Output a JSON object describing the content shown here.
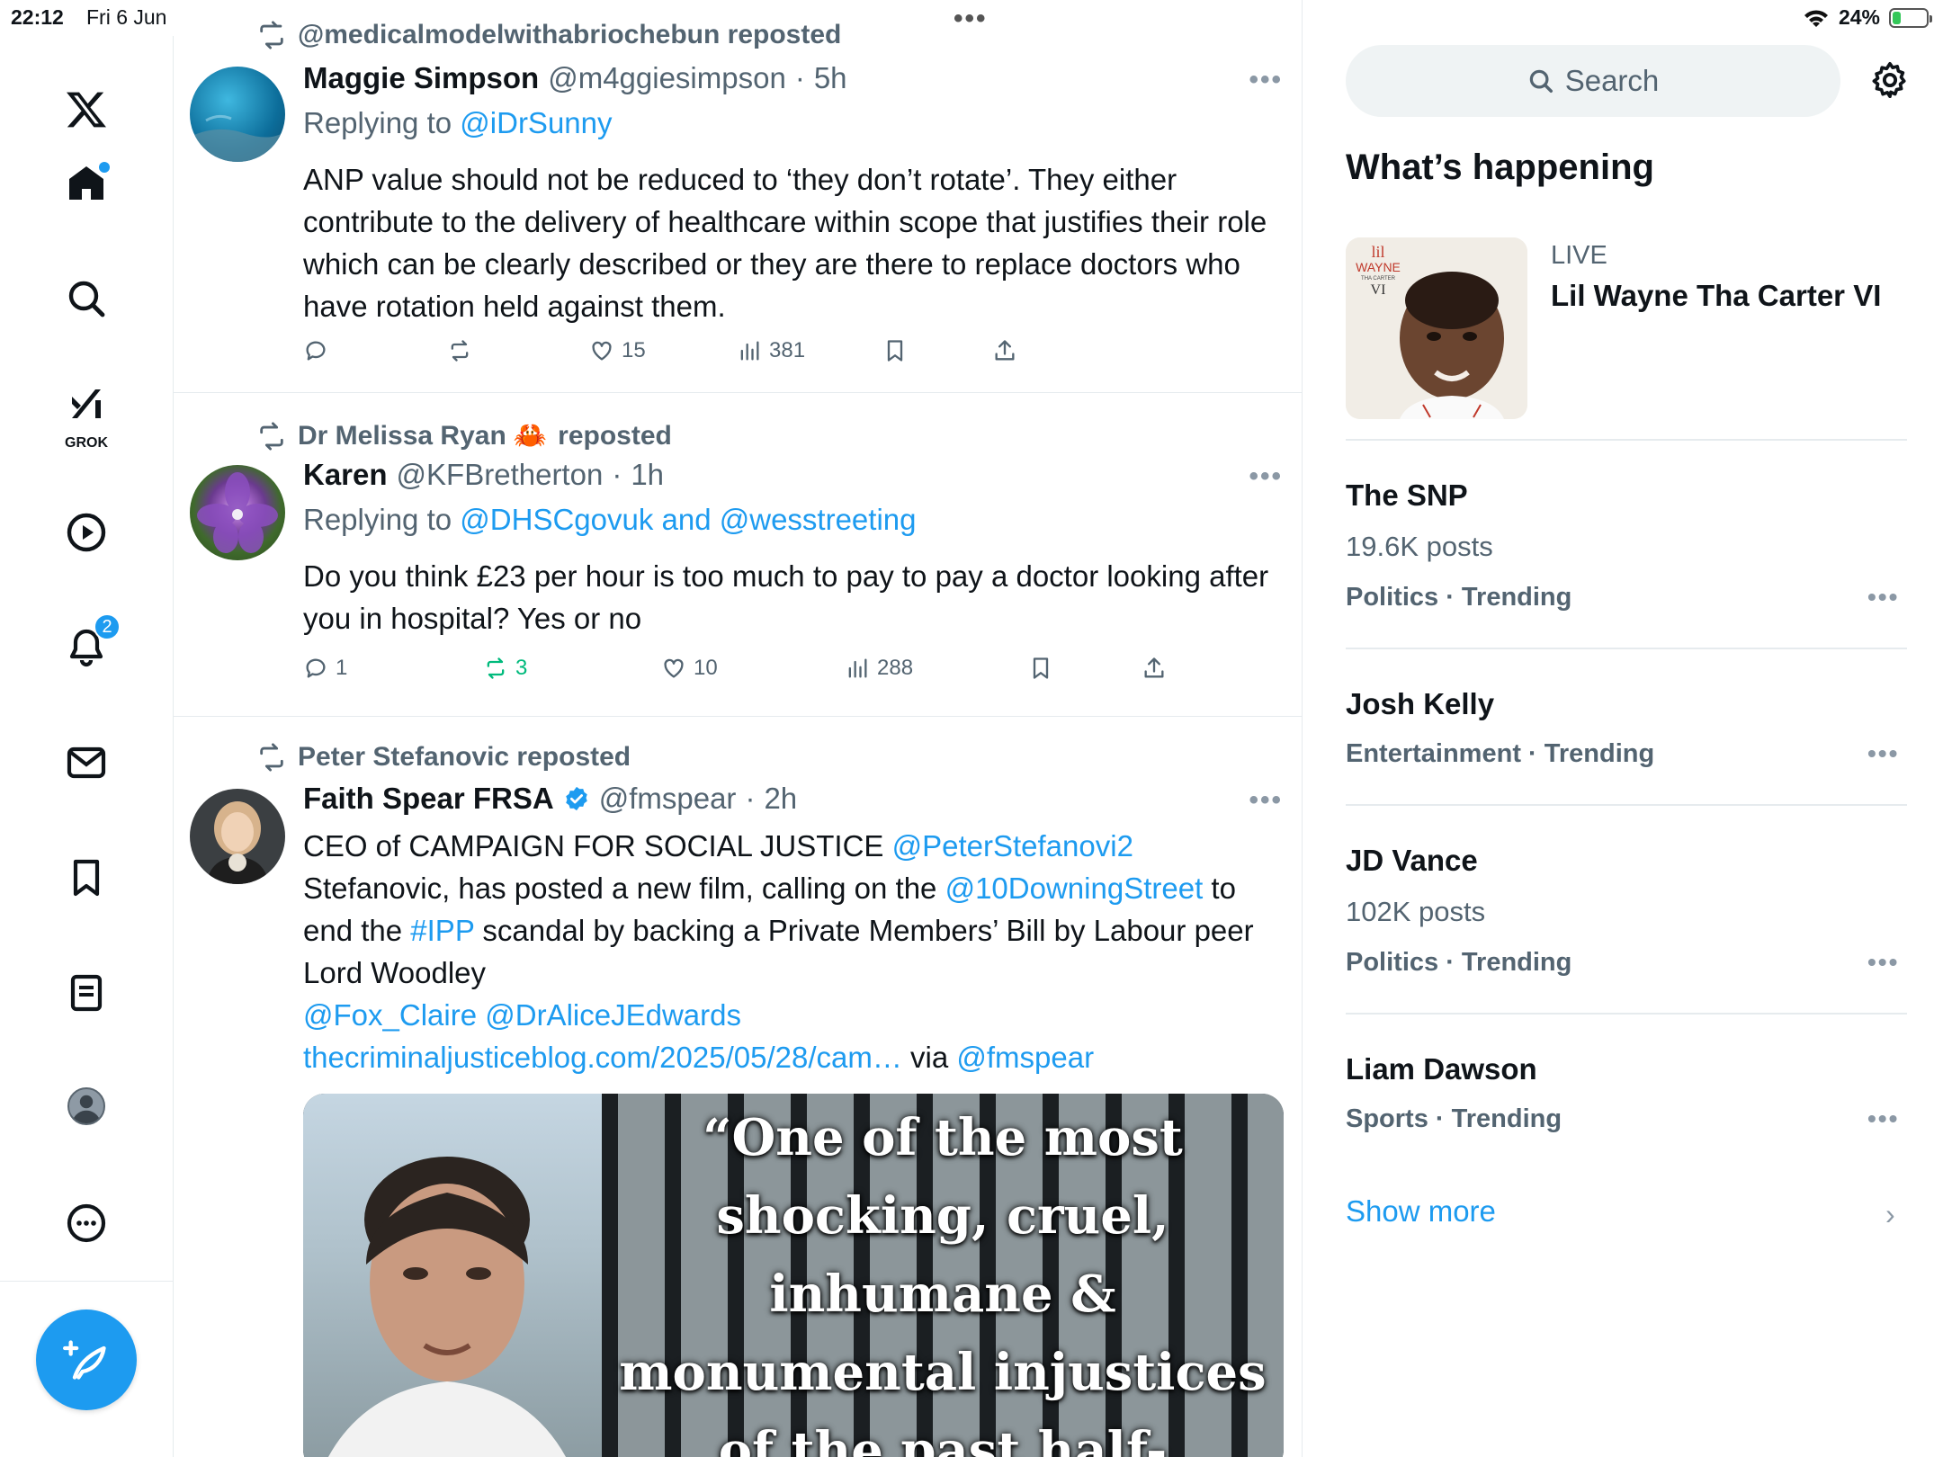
{
  "status_bar": {
    "time": "22:12",
    "date": "Fri 6 Jun",
    "battery": "24%",
    "battery_level": 0.24
  },
  "nav": {
    "notifications_badge": "2",
    "grok_label": "GROK"
  },
  "posts": [
    {
      "reposted_by": "@medicalmodelwithabriochebun reposted",
      "name": "Maggie Simpson",
      "handle": "@m4ggiesimpson",
      "time": "5h",
      "replying_prefix": "Replying to",
      "replying_to": "@iDrSunny",
      "text": "ANP value should not be reduced to ‘they don’t rotate’. They either contribute to the delivery of healthcare within scope that justifies their role which can be clearly described or they are there to replace doctors who have rotation held against them.",
      "replies": "",
      "reposts": "",
      "likes": "15",
      "views": "381"
    },
    {
      "reposted_by_name": "Dr Melissa Ryan",
      "reposted_by_emoji": "🦀",
      "reposted_suffix": "reposted",
      "name": "Karen",
      "handle": "@KFBretherton",
      "time": "1h",
      "replying_prefix": "Replying to",
      "replying_to": "@DHSCgovuk and @wesstreeting",
      "text": "Do you think  £23 per hour is too much to pay to pay a doctor looking after you in hospital? Yes or no",
      "replies": "1",
      "reposts": "3",
      "likes": "10",
      "views": "288"
    },
    {
      "reposted_by": "Peter Stefanovic reposted",
      "name": "Faith Spear FRSA",
      "handle": "@fmspear",
      "time": "2h",
      "text_1": "CEO of CAMPAIGN FOR SOCIAL JUSTICE ",
      "mention_1": "@PeterStefanovi2",
      "text_2": "Stefanovic, has posted a new film, calling on the ",
      "mention_2": "@10DowningStreet",
      "text_3": " to end the ",
      "hashtag": "#IPP",
      "text_4": " scandal by backing a Private Members’ Bill by Labour peer Lord Woodley",
      "mention_3": "@Fox_Claire",
      "mention_4": "@DrAliceJEdwards",
      "url": "thecriminaljusticeblog.com/2025/05/28/cam…",
      "via": " via ",
      "mention_5": "@fmspear",
      "media_quote_lines": [
        "“One of the most",
        "shocking, cruel,",
        "inhumane &",
        "monumental injustices",
        "of the past half-"
      ]
    }
  ],
  "sidebar": {
    "search_placeholder": "Search",
    "whats_happening": "What’s happening",
    "live": {
      "label": "LIVE",
      "title": "Lil Wayne Tha Carter VI",
      "art_text_1": "lil",
      "art_text_2": "WAYNE",
      "art_text_3": "THA CARTER",
      "art_text_4": "VI"
    },
    "trends": [
      {
        "name": "The SNP",
        "posts": "19.6K posts",
        "category": "Politics · Trending"
      },
      {
        "name": "Josh Kelly",
        "posts": "",
        "category": "Entertainment · Trending"
      },
      {
        "name": "JD Vance",
        "posts": "102K posts",
        "category": "Politics · Trending"
      },
      {
        "name": "Liam Dawson",
        "posts": "",
        "category": "Sports · Trending"
      }
    ],
    "show_more": "Show more"
  },
  "colors": {
    "accent": "#1d9bf0",
    "repost_green": "#00ba7c",
    "secondary_text": "#536471"
  }
}
